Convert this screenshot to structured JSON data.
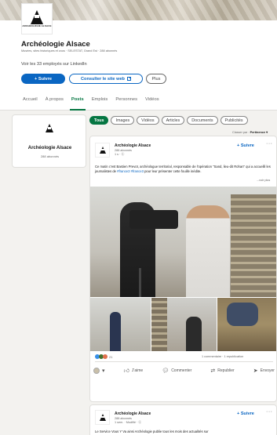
{
  "company": {
    "name": "Archéologie Alsace",
    "logo_text": "ARCHÉOLOGIE ALSACE",
    "meta": "Musées, sites historiques et zoos · SELESTAT, Grand Est · 288 abonnés",
    "employees_link": "Voir les 33 employés sur LinkedIn",
    "follow_label": "+ Suivre",
    "website_label": "Consulter le site web",
    "plus_label": "Plus"
  },
  "tabs": [
    {
      "label": "Accueil",
      "active": false
    },
    {
      "label": "À propos",
      "active": false
    },
    {
      "label": "Posts",
      "active": true
    },
    {
      "label": "Emplois",
      "active": false
    },
    {
      "label": "Personnes",
      "active": false
    },
    {
      "label": "Vidéos",
      "active": false
    }
  ],
  "sidebar": {
    "name": "Archéologie Alsace",
    "followers": "288 abonnés"
  },
  "filters": [
    "Tous",
    "Images",
    "Vidéos",
    "Articles",
    "Documents",
    "Publicités"
  ],
  "sort": {
    "label": "Classer par :",
    "value": "Pertinence ▾"
  },
  "post": {
    "author": "Archéologie Alsace",
    "followers": "288 abonnés",
    "time": "1 s · ⓔ",
    "follow_label": "+ Suivre",
    "more_label": "···",
    "text_part1": "Ce matin c'est Bastien Prevot, archéologue territorial, responsable de l'opération \"Sand, lieu-dit Rohan\" qui a accueilli les journalistes de ",
    "tag1": "#france3",
    "text_part2": " ",
    "tag2": "#france3",
    "text_part3": " pour leur présenter cette fouille inédite.",
    "see_more": "...voir plus",
    "reaction_count": "21",
    "counts": "1 commentaire · 1 republication",
    "actions": {
      "like": "J'aime",
      "comment": "Commenter",
      "repost": "Republier",
      "send": "Envoyer"
    }
  },
  "post2": {
    "author": "Archéologie Alsace",
    "followers": "288 abonnés",
    "time": "1 sem. · Modifié · ⓔ",
    "follow_label": "+ Suivre",
    "more_label": "···",
    "text": "Le Service Vous Y Va ainsi Archéologie publie tous les mois des actualités sur"
  },
  "colors": {
    "accent": "#0a66c2",
    "active_tab": "#057642"
  }
}
